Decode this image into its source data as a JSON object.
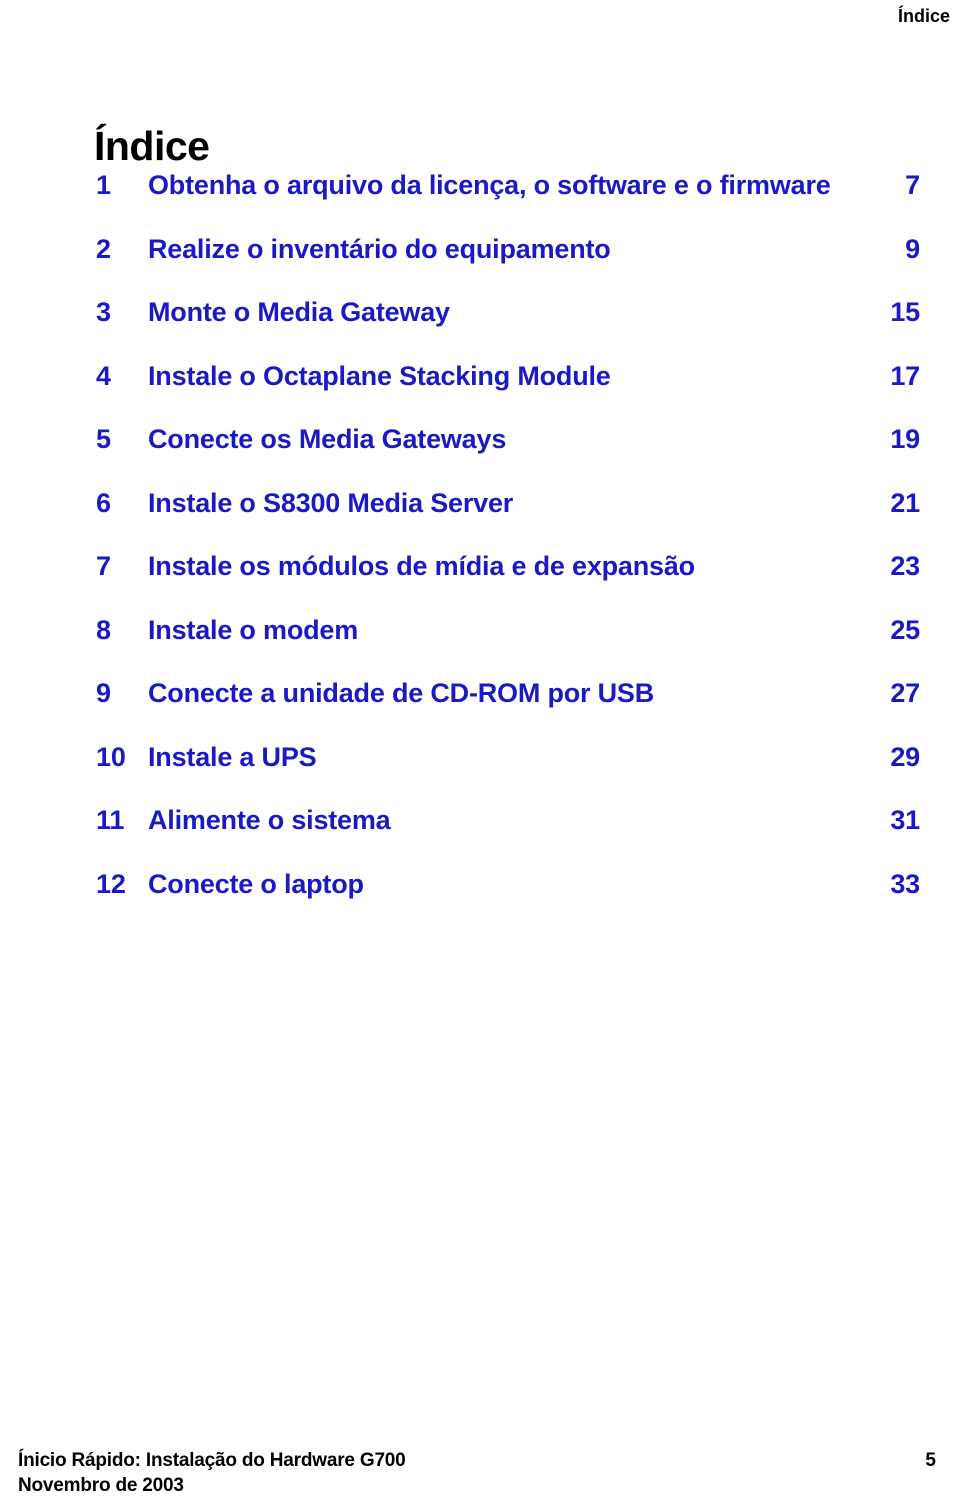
{
  "document": {
    "running_header": "Índice",
    "title": "Índice",
    "accent_color": "#1a1ac4",
    "text_color": "#000000",
    "background_color": "#ffffff"
  },
  "toc": {
    "entries": [
      {
        "number": "1",
        "label": "Obtenha o arquivo da licença, o software e o firmware",
        "page": "7"
      },
      {
        "number": "2",
        "label": "Realize o inventário do equipamento",
        "page": "9"
      },
      {
        "number": "3",
        "label": "Monte o Media Gateway",
        "page": "15"
      },
      {
        "number": "4",
        "label": "Instale o Octaplane Stacking Module",
        "page": "17"
      },
      {
        "number": "5",
        "label": "Conecte os Media Gateways",
        "page": "19"
      },
      {
        "number": "6",
        "label": "Instale o S8300 Media Server",
        "page": "21"
      },
      {
        "number": "7",
        "label": "Instale os módulos de mídia e de expansão",
        "page": "23"
      },
      {
        "number": "8",
        "label": "Instale o modem",
        "page": "25"
      },
      {
        "number": "9",
        "label": "Conecte a unidade de CD-ROM por USB",
        "page": "27"
      },
      {
        "number": "10",
        "label": "Instale a UPS",
        "page": "29"
      },
      {
        "number": "11",
        "label": "Alimente o sistema",
        "page": "31"
      },
      {
        "number": "12",
        "label": "Conecte o laptop",
        "page": "33"
      }
    ]
  },
  "footer": {
    "line1": "Ínicio Rápido: Instalação do Hardware G700",
    "line2": "Novembro de 2003",
    "page_number": "5"
  }
}
